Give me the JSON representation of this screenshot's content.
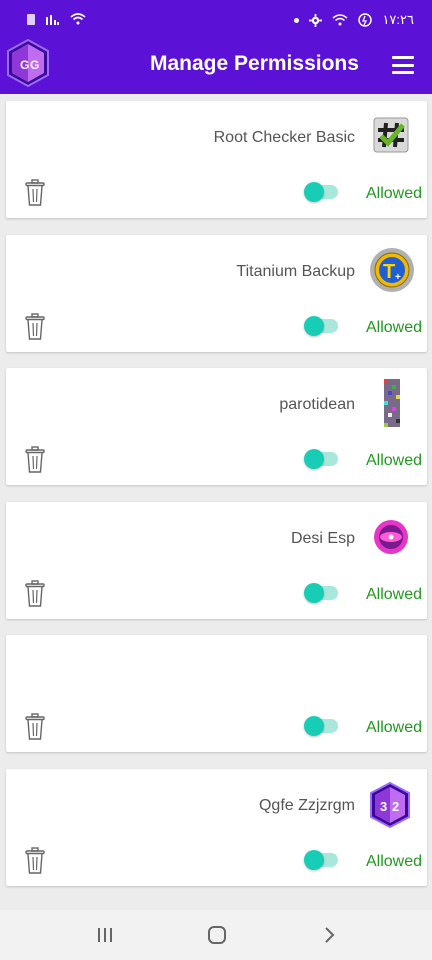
{
  "status_bar": {
    "time": "١٧:٢٦"
  },
  "app_bar": {
    "title": "Manage Permissions",
    "logo_text": "GG"
  },
  "permissions": [
    {
      "app_name": "Root Checker Basic",
      "icon": "root-checker-icon",
      "status": "Allowed",
      "enabled": true
    },
    {
      "app_name": "Titanium Backup",
      "icon": "titanium-backup-icon",
      "status": "Allowed",
      "enabled": true
    },
    {
      "app_name": "parotidean",
      "icon": "noise-app-icon",
      "status": "Allowed",
      "enabled": true
    },
    {
      "app_name": "Desi Esp",
      "icon": "desi-esp-icon",
      "status": "Allowed",
      "enabled": true
    },
    {
      "app_name": "",
      "icon": "",
      "status": "Allowed",
      "enabled": true
    },
    {
      "app_name": "Qgfe Zzjzrgm",
      "icon": "gameguardian-32-icon",
      "status": "Allowed",
      "enabled": true
    }
  ],
  "colors": {
    "primary": "#5b12d6",
    "toggle_on": "#17cdb6",
    "allowed_text": "#1f9b1f"
  }
}
